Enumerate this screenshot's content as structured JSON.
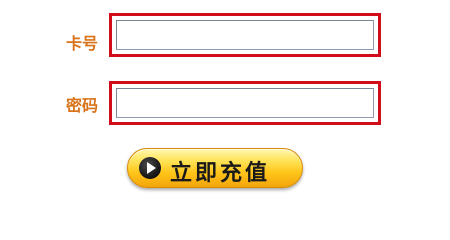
{
  "form": {
    "card_label": "卡号",
    "card_value": "",
    "password_label": "密码",
    "password_value": "",
    "submit_label": "立即充值",
    "highlight_color": "#d10d1b",
    "label_color": "#d9731a",
    "button_color": "#ffc51a"
  }
}
